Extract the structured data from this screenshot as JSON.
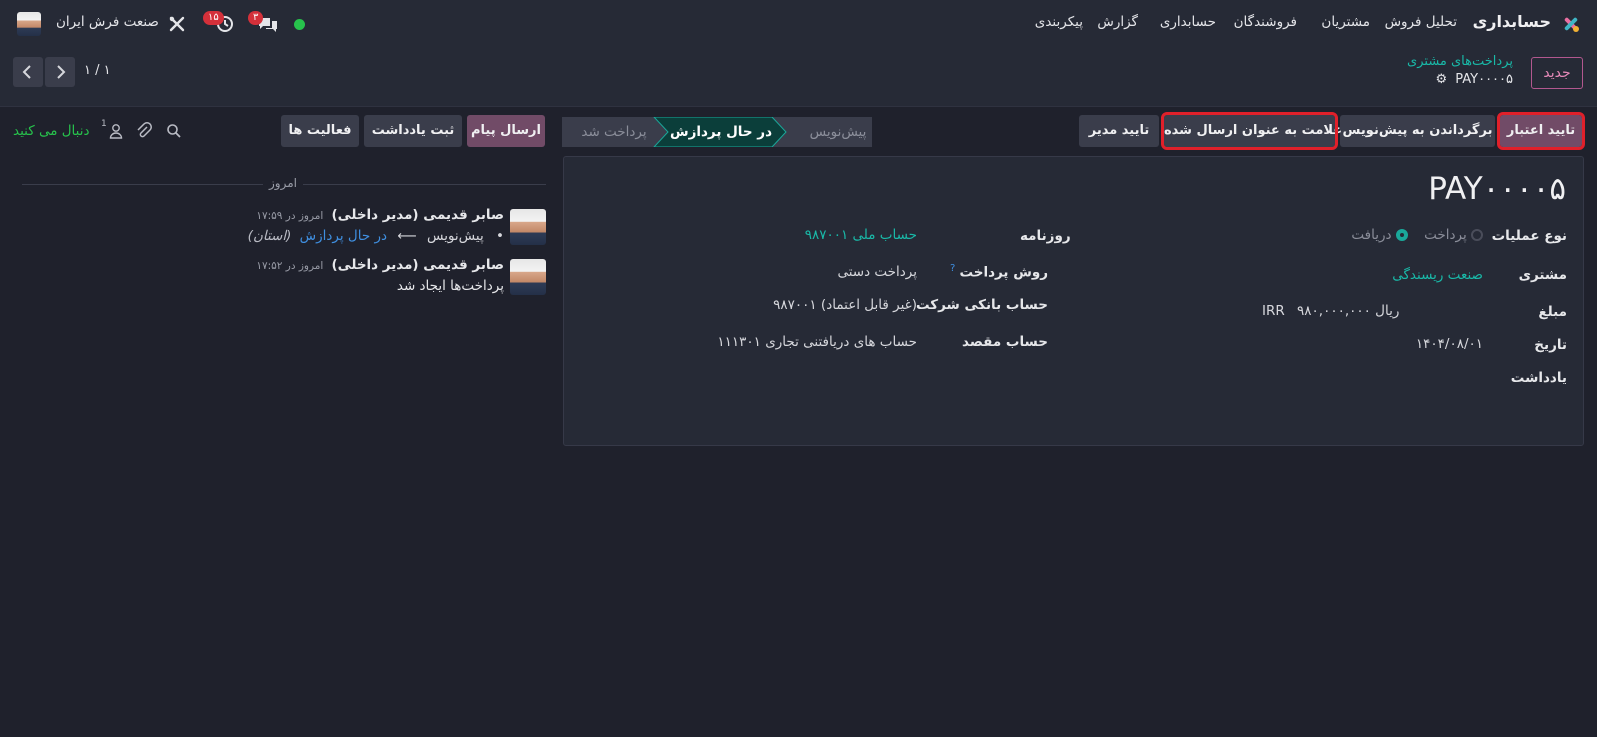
{
  "topbar": {
    "app_name": "حسابداری",
    "menu": [
      "تحلیل فروش",
      "مشتریان",
      "فروشندگان",
      "حسابداری",
      "گزارش",
      "پیکربندی"
    ],
    "company": "صنعت فرش ایران",
    "activity_count": "۱۵",
    "message_count": "۳"
  },
  "breadcrumb": {
    "parent": "پرداخت‌های مشتری",
    "current": "PAY۰۰۰۰۵"
  },
  "cpanel": {
    "new_label": "جدید",
    "pager": "۱ / ۱"
  },
  "actions": {
    "confirm_credit": "تایید اعتبار",
    "reset_draft": "برگرداندن به پیش‌نویس",
    "mark_sent": "علامت به عنوان ارسال شده",
    "manager_approve": "تایید مدیر"
  },
  "stages": {
    "draft": "پیش‌نویس",
    "processing": "در حال پردازش",
    "paid": "پرداخت شد"
  },
  "chatter_buttons": {
    "send_message": "ارسال پیام",
    "log_note": "ثبت یادداشت",
    "activities": "فعالیت ها",
    "follow": "دنبال می کنید",
    "followers_count": "1"
  },
  "form": {
    "title": "PAY۰۰۰۰۵",
    "operation_type_label": "نوع عملیات",
    "operation_options": [
      "پرداخت",
      "دریافت"
    ],
    "customer_label": "مشتری",
    "customer_value": "صنعت ریسندگی",
    "amount_label": "مبلغ",
    "amount_value": "ریال ۹۸۰,۰۰۰,۰۰۰",
    "amount_currency": "IRR",
    "date_label": "تاریخ",
    "date_value": "۱۴۰۴/۰۸/۰۱",
    "note_label": "یادداشت",
    "journal_label": "روزنامه",
    "journal_value": "حساب ملی ۹۸۷۰۰۱",
    "payment_method_label": "روش پرداخت",
    "payment_method_help": "?",
    "payment_method_value": "پرداخت دستی",
    "bank_account_label": "حساب بانکی شرکت",
    "bank_account_value": "۹۸۷۰۰۱ (غیر قابل اعتماد)",
    "dest_account_label": "حساب مقصد",
    "dest_account_value": "۱۱۱۳۰۱ حساب های دریافتنی تجاری"
  },
  "chatter": {
    "day_separator": "امروز",
    "messages": [
      {
        "author": "صابر قدیمی (مدیر داخلی)",
        "time": "امروز در ۱۷:۵۹",
        "old_stage": "پیش‌نویس",
        "arrow": "⟵",
        "new_stage": "در حال پردازش",
        "field": "(استان)"
      },
      {
        "author": "صابر قدیمی (مدیر داخلی)",
        "time": "امروز در ۱۷:۵۲",
        "body": "پرداخت‌ها ایجاد شد"
      }
    ]
  },
  "colors": {
    "accent": "#19b9a8",
    "primary": "#714b67",
    "highlight": "#e0202a",
    "online": "#27c24c"
  }
}
